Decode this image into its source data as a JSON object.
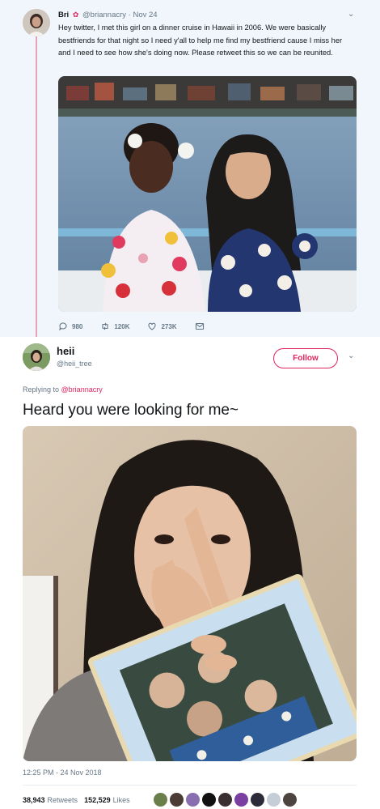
{
  "tweet1": {
    "name": "Bri",
    "flower": "✿",
    "handle": "@briannacry",
    "separator": "·",
    "date": "Nov 24",
    "text": "Hey twitter, I met this girl on a dinner cruise in Hawaii in 2006. We were basically bestfriends for that night so I need y'all to help me find my bestfriend cause I miss her and I need to see how she's doing now. Please retweet this so we can be reunited.",
    "replies": "980",
    "retweets": "120K",
    "likes": "273K"
  },
  "tweet2": {
    "name": "heii",
    "handle": "@heii_tree",
    "follow_label": "Follow",
    "replying_prefix": "Replying to",
    "replying_handle": "@briannacry",
    "text": "Heard you were looking for me~",
    "timestamp": "12:25 PM - 24 Nov 2018",
    "retweet_count": "38,943",
    "retweet_label": "Retweets",
    "like_count": "152,529",
    "like_label": "Likes"
  },
  "icons": {
    "more": "chevron-down-icon",
    "reply": "reply-icon",
    "retweet": "retweet-icon",
    "like": "heart-icon",
    "dm": "envelope-icon"
  },
  "colors": {
    "accent": "#e0245e",
    "muted": "#657786",
    "text": "#14171a",
    "tweet1_bg": "#f0f6fb",
    "thread_line": "#e8a0b4"
  }
}
